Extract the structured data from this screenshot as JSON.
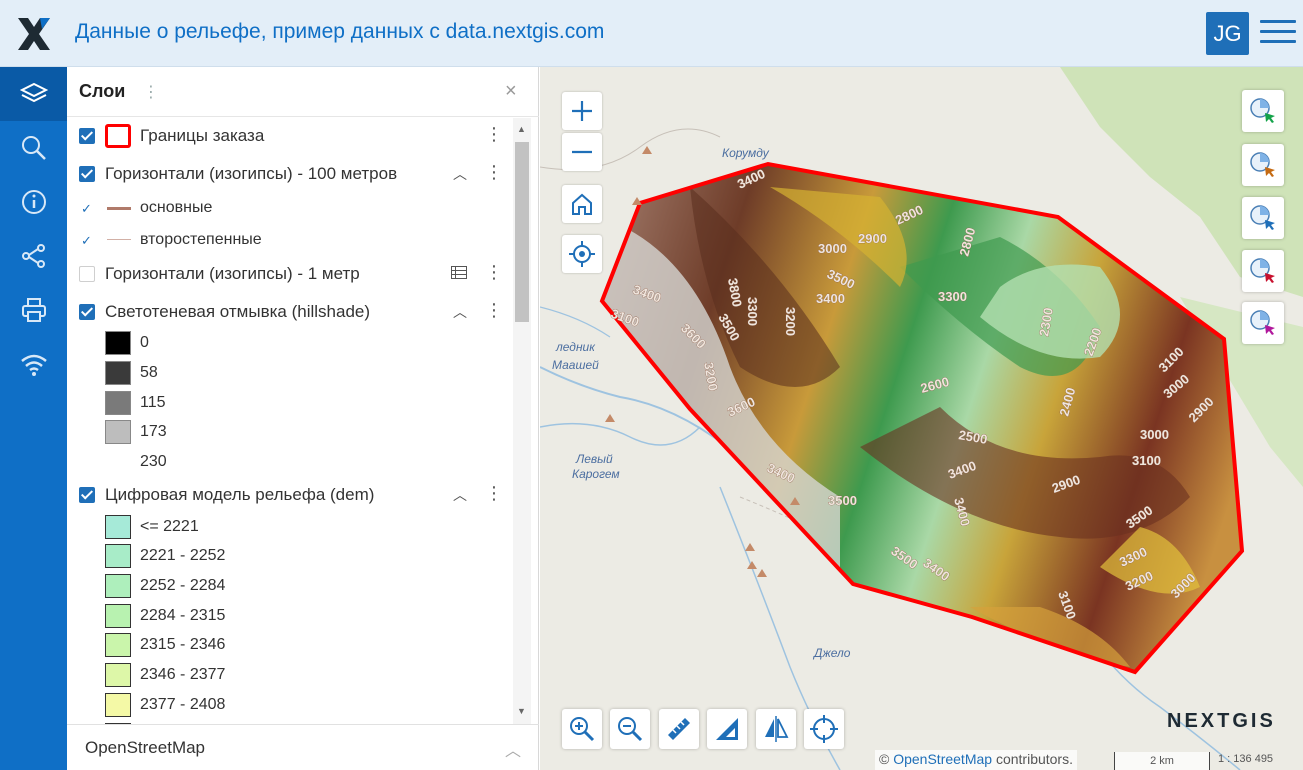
{
  "header": {
    "title": "Данные о рельефе, пример данных с data.nextgis.com",
    "user_initials": "JG"
  },
  "panel": {
    "title": "Слои",
    "footer_label": "OpenStreetMap"
  },
  "layers": {
    "order_bounds": "Границы заказа",
    "contours_100": "Горизонтали (изогипсы) - 100 метров",
    "contours_100_main": "основные",
    "contours_100_secondary": "второстепенные",
    "contours_1": "Горизонтали (изогипсы) - 1 метр",
    "hillshade": "Светотеневая отмывка (hillshade)",
    "hillshade_legend": [
      "0",
      "58",
      "115",
      "173",
      "230"
    ],
    "dem": "Цифровая модель рельефа (dem)",
    "dem_legend": [
      "<= 2221",
      "2221 - 2252",
      "2252 - 2284",
      "2284 - 2315",
      "2315 - 2346",
      "2346 - 2377",
      "2377 - 2408"
    ]
  },
  "colors": {
    "accent": "#0f6fc6",
    "header_bg": "#e3eef8",
    "boundary": "#ff0000",
    "hillshade_swatches": [
      "#000000",
      "#3a3a3a",
      "#7a7a7a",
      "#bdbdbd",
      "#ffffff"
    ],
    "dem_swatches": [
      "#a6ead8",
      "#a8ecc8",
      "#aeefbc",
      "#b8f2b0",
      "#caf5ab",
      "#ddf7a8",
      "#f4f9a6"
    ]
  },
  "map": {
    "attribution_prefix": "©",
    "attribution_link": "OpenStreetMap",
    "attribution_suffix": "contributors.",
    "scale_label": "2 km",
    "scale_ratio": "1 : 136 495",
    "logo": "NEXTGIS",
    "place_names": [
      "Корумду",
      "ледник",
      "Маашей",
      "Левый",
      "Карогем",
      "Джело"
    ],
    "contour_labels": [
      "3400",
      "2800",
      "3000",
      "2900",
      "2800",
      "3800",
      "3500",
      "3400",
      "3300",
      "3400",
      "3100",
      "3600",
      "3500",
      "3300",
      "3200",
      "3200",
      "2300",
      "2200",
      "3100",
      "3000",
      "2900",
      "2600",
      "2400",
      "3600",
      "2500",
      "3000",
      "3100",
      "3400",
      "3400",
      "2900",
      "3500",
      "3400",
      "3500",
      "3500",
      "3400",
      "3300",
      "3200",
      "3000",
      "3100"
    ]
  }
}
